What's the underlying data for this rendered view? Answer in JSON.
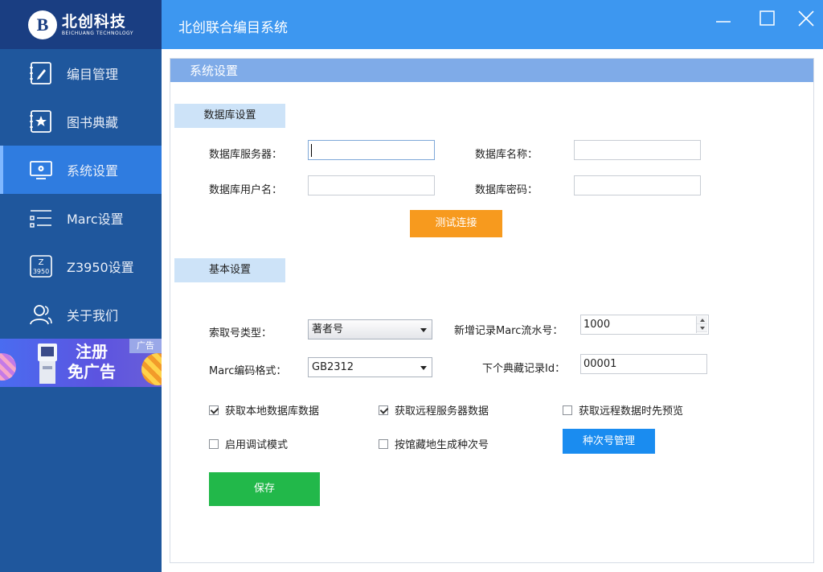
{
  "app": {
    "title": "北创联合编目系统",
    "logo_name": "北创科技",
    "logo_en": "BEICHUANG TECHNOLOGY",
    "logo_mark": "B"
  },
  "sidebar": {
    "items": [
      {
        "label": "编目管理",
        "icon": "edit-book-icon",
        "active": false
      },
      {
        "label": "图书典藏",
        "icon": "star-book-icon",
        "active": false
      },
      {
        "label": "系统设置",
        "icon": "monitor-gear-icon",
        "active": true
      },
      {
        "label": "Marc设置",
        "icon": "sliders-icon",
        "active": false
      },
      {
        "label": "Z3950设置",
        "icon": "z3950-icon",
        "active": false
      },
      {
        "label": "关于我们",
        "icon": "users-icon",
        "active": false
      }
    ],
    "ad": {
      "line1": "注册",
      "line2": "免广告",
      "tag": "广告"
    }
  },
  "main": {
    "header": "系统设置",
    "db_section": {
      "label": "数据库设置",
      "server_label": "数据库服务器：",
      "server_value": "",
      "name_label": "数据库名称：",
      "name_value": "",
      "user_label": "数据库用户名：",
      "user_value": "",
      "password_label": "数据库密码：",
      "password_value": "",
      "test_button": "测试连接"
    },
    "basic_section": {
      "label": "基本设置",
      "call_type_label": "索取号类型：",
      "call_type_value": "著者号",
      "marc_seq_label": "新增记录Marc流水号：",
      "marc_seq_value": "1000",
      "marc_encoding_label": "Marc编码格式：",
      "marc_encoding_value": "GB2312",
      "next_id_label": "下个典藏记录Id：",
      "next_id_value": "00001",
      "checkboxes": [
        {
          "label": "获取本地数据库数据",
          "checked": true
        },
        {
          "label": "获取远程服务器数据",
          "checked": true
        },
        {
          "label": "获取远程数据时先预览",
          "checked": false
        },
        {
          "label": "启用调试模式",
          "checked": false
        },
        {
          "label": "按馆藏地生成种次号",
          "checked": false
        }
      ],
      "seq_manage_button": "种次号管理",
      "save_button": "保存"
    }
  },
  "colors": {
    "sidebar": "#1f579d",
    "titlebar": "#3d97f0",
    "test_button": "#f79a1e",
    "seq_button": "#1a8cf0",
    "save_button": "#22b84a"
  }
}
